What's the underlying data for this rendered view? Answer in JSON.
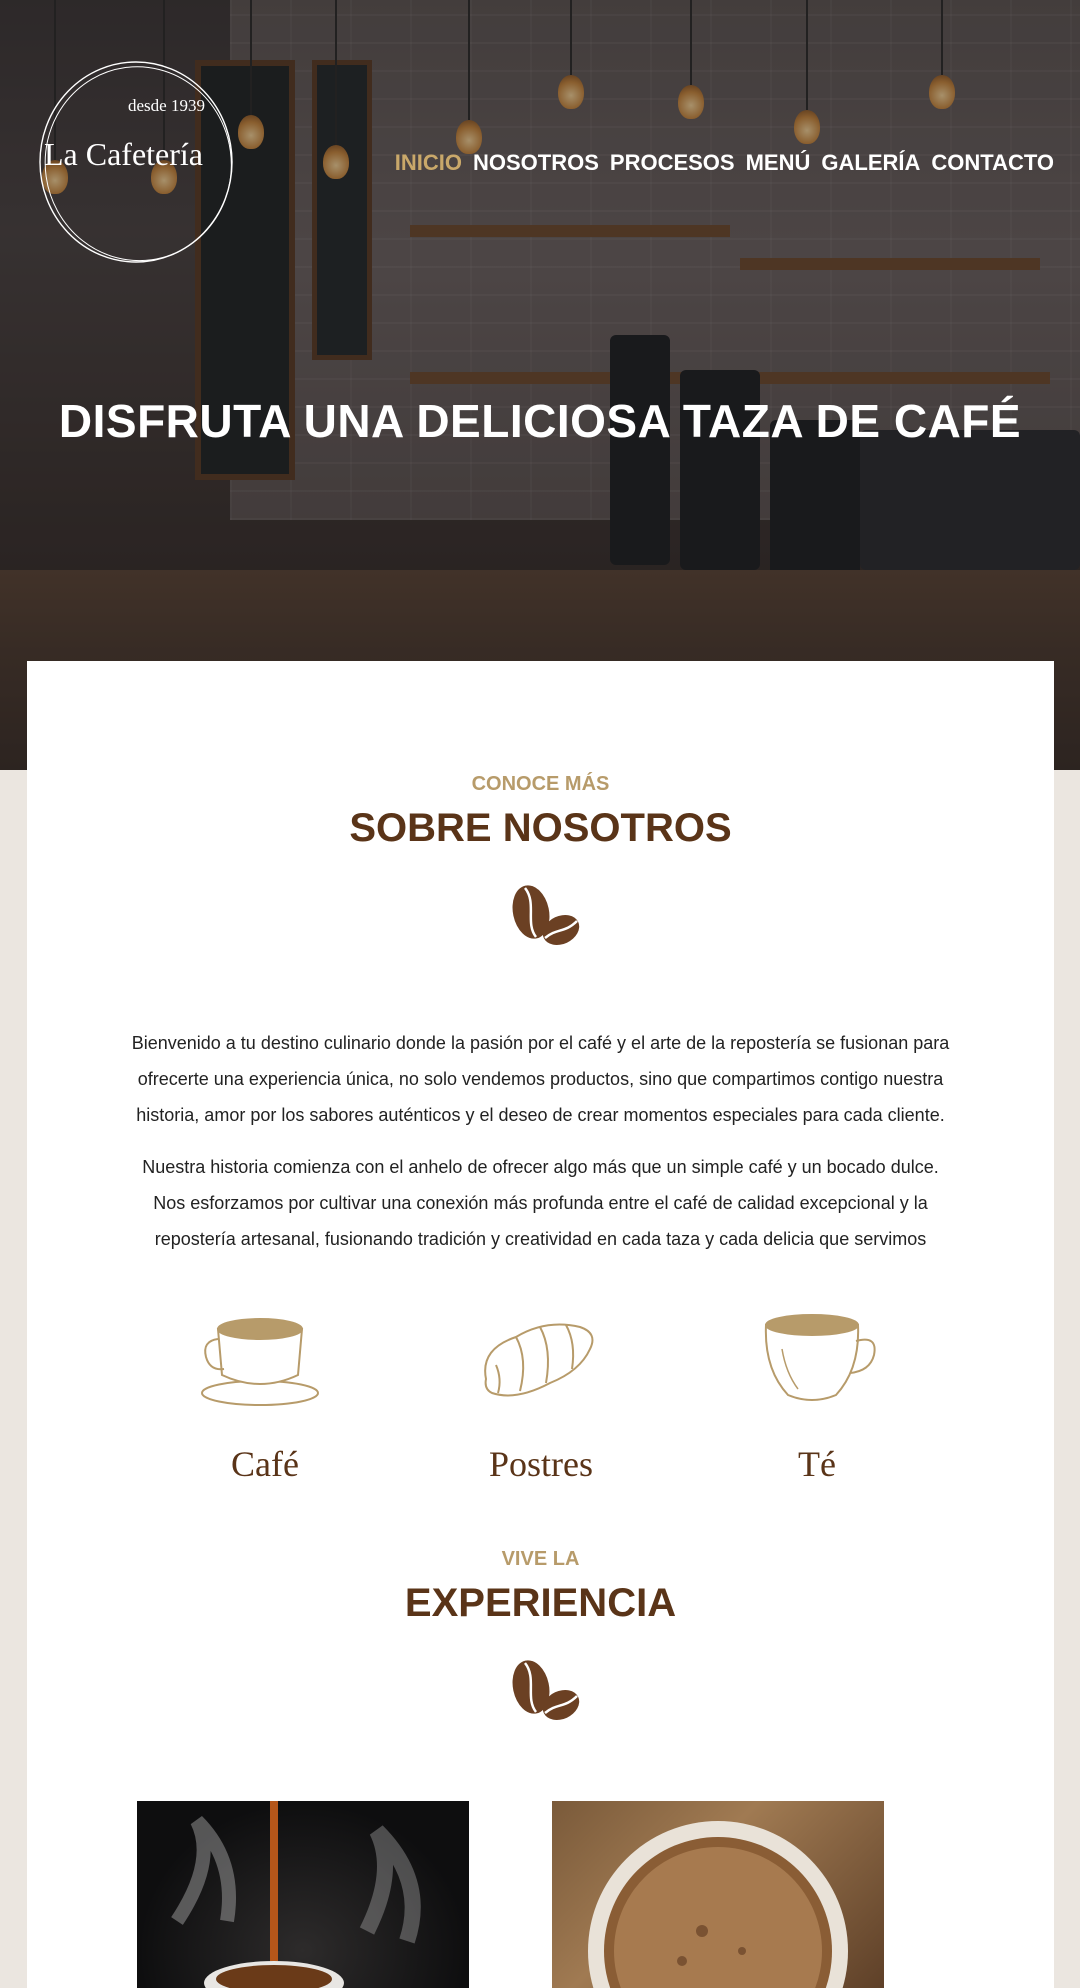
{
  "logo": {
    "since": "desde 1939",
    "name": "La Cafetería"
  },
  "nav": [
    {
      "label": "INICIO",
      "active": true
    },
    {
      "label": "NOSOTROS",
      "active": false
    },
    {
      "label": "PROCESOS",
      "active": false
    },
    {
      "label": "MENÚ",
      "active": false
    },
    {
      "label": "GALERÍA",
      "active": false
    },
    {
      "label": "CONTACTO",
      "active": false
    }
  ],
  "hero": {
    "title": "DISFRUTA UNA DELICIOSA TAZA DE CAFÉ"
  },
  "about": {
    "eyebrow": "CONOCE MÁS",
    "title": "SOBRE NOSOTROS",
    "paragraphs": [
      "Bienvenido a tu destino culinario donde la pasión por el café y el arte de la repostería se fusionan para ofrecerte una experiencia única, no solo vendemos productos, sino que compartimos contigo nuestra historia, amor por los sabores auténticos y el deseo de crear momentos especiales para cada cliente.",
      "Nuestra historia comienza con el anhelo de ofrecer algo más que un simple café y un bocado dulce. Nos esforzamos por cultivar una conexión más profunda entre el café de calidad excepcional y la repostería artesanal, fusionando tradición y creatividad en cada taza y cada delicia que servimos"
    ]
  },
  "features": [
    {
      "label": "Café",
      "icon": "coffee-cup-icon"
    },
    {
      "label": "Postres",
      "icon": "croissant-icon"
    },
    {
      "label": "Té",
      "icon": "tea-cup-icon"
    }
  ],
  "experience": {
    "eyebrow": "VIVE LA",
    "title": "EXPERIENCIA"
  },
  "colors": {
    "accent": "#c9a86a",
    "brown": "#5a3418",
    "gold": "#b79b6a",
    "background": "#ebe6e0"
  }
}
